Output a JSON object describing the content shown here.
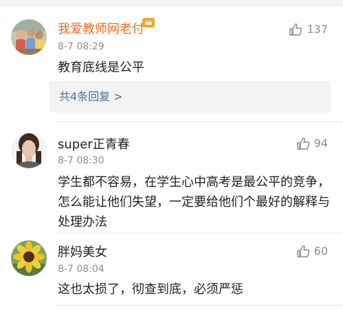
{
  "comments": [
    {
      "username": "我爱教师网老付",
      "time": "8-7 08:29",
      "likes": "137",
      "text": "教育底线是公平",
      "reply_text": "共4条回复 >",
      "username_color": "#f06a1e",
      "icons": {
        "avatar": "avatar-kids-icon",
        "vip": "crown-badge-icon",
        "verified": "verified-badge-icon",
        "like": "thumbs-up-icon"
      }
    },
    {
      "username": "super正青春",
      "time": "8-7 08:30",
      "likes": "94",
      "text": "学生都不容易，在学生心中高考是最公平的竞争，怎么能让他们失望，一定要给他们个最好的解释与处理办法",
      "text_lines": [
        "学生都不容易，在学生心中高考是最公平的竞争，",
        "怎么能让他们失望，一定要给他们个最好的解释与",
        "处理办法"
      ],
      "icons": {
        "avatar": "avatar-portrait-icon",
        "like": "thumbs-up-icon"
      }
    },
    {
      "username": "胖妈美女",
      "time": "8-7 08:04",
      "likes": "60",
      "text": "这也太损了，彻查到底，必须严惩",
      "icons": {
        "avatar": "avatar-sunflower-icon",
        "like": "thumbs-up-icon"
      }
    }
  ]
}
